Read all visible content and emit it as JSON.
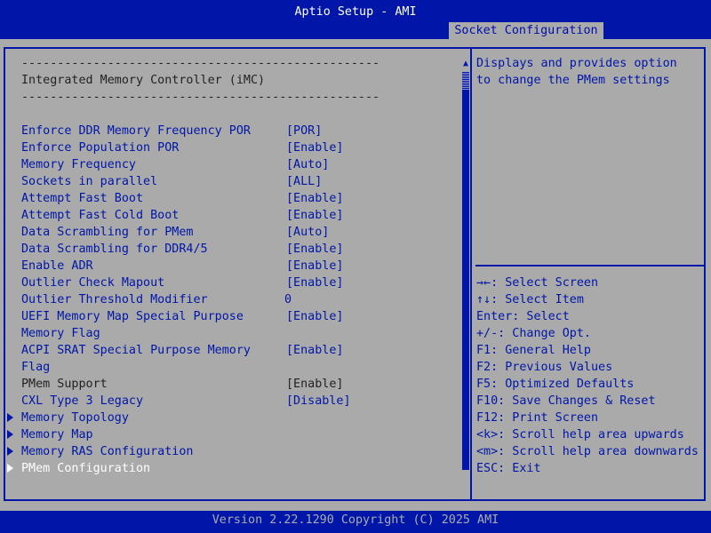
{
  "header": {
    "title": "Aptio Setup - AMI",
    "active_tab": "Socket Configuration"
  },
  "section": {
    "separator": "--------------------------------------------------",
    "title": "Integrated Memory Controller (iMC)"
  },
  "settings": [
    {
      "label": "Enforce DDR Memory Frequency POR",
      "value": "[POR]"
    },
    {
      "label": "Enforce Population POR",
      "value": "[Enable]"
    },
    {
      "label": "Memory Frequency",
      "value": "[Auto]"
    },
    {
      "label": "Sockets in parallel",
      "value": "[ALL]"
    },
    {
      "label": "Attempt Fast Boot",
      "value": "[Enable]"
    },
    {
      "label": "Attempt Fast Cold Boot",
      "value": "[Enable]"
    },
    {
      "label": "Data Scrambling for PMem",
      "value": "[Auto]"
    },
    {
      "label": "Data Scrambling for DDR4/5",
      "value": "[Enable]"
    },
    {
      "label": "Enable ADR",
      "value": "[Enable]"
    },
    {
      "label": "Outlier Check Mapout",
      "value": "[Enable]"
    },
    {
      "label": "Outlier Threshold Modifier",
      "value": "0"
    },
    {
      "label": "UEFI Memory Map Special Purpose",
      "label2": "Memory Flag",
      "value": "[Enable]"
    },
    {
      "label": "ACPI SRAT Special Purpose Memory",
      "label2": "Flag",
      "value": "[Enable]"
    },
    {
      "label": "PMem Support",
      "value": "[Enable]"
    },
    {
      "label": "CXL Type 3 Legacy",
      "value": "[Disable]"
    }
  ],
  "submenus": [
    {
      "label": "Memory Topology"
    },
    {
      "label": "Memory Map"
    },
    {
      "label": "Memory RAS Configuration"
    },
    {
      "label": "PMem Configuration",
      "selected": true
    }
  ],
  "help": {
    "line1": "Displays and provides option",
    "line2": "to change the PMem settings"
  },
  "keys": [
    "→←: Select Screen",
    "↑↓: Select Item",
    "Enter: Select",
    "+/-: Change Opt.",
    "F1: General Help",
    "F2: Previous Values",
    "F5: Optimized Defaults",
    "F10: Save Changes & Reset",
    "F12: Print Screen",
    "<k>: Scroll help area upwards",
    "<m>: Scroll help area downwards",
    "ESC: Exit"
  ],
  "scrollbar": {
    "up_icon": "▲",
    "down_icon": "▼"
  },
  "footer": "Version 2.22.1290 Copyright (C) 2025 AMI"
}
